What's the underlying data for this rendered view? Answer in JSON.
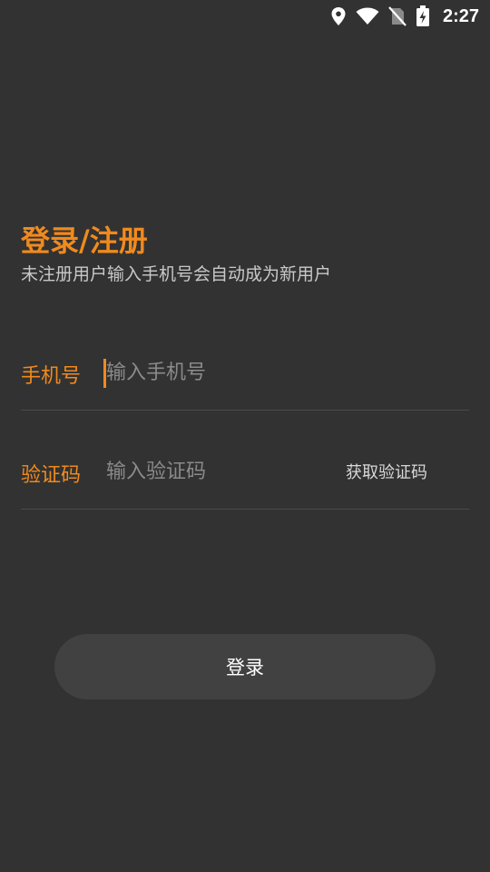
{
  "status_bar": {
    "time": "2:27",
    "icons": [
      "location-icon",
      "wifi-icon",
      "no-sim-icon",
      "battery-charging-icon"
    ]
  },
  "header": {
    "title": "登录/注册",
    "subtitle": "未注册用户输入手机号会自动成为新用户"
  },
  "form": {
    "phone": {
      "label": "手机号",
      "placeholder": "输入手机号",
      "value": ""
    },
    "code": {
      "label": "验证码",
      "placeholder": "输入验证码",
      "value": "",
      "get_code_label": "获取验证码"
    }
  },
  "login_button": {
    "label": "登录"
  },
  "colors": {
    "background": "#323232",
    "accent": "#f08a1e",
    "button": "#414141"
  }
}
